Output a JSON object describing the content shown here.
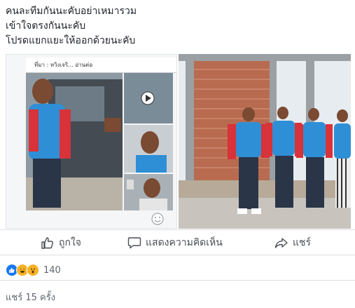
{
  "post": {
    "lines": [
      "คนละทีมกันนะคับอย่าเหมารวม",
      "เข้าใจตรงกันนะคับ",
      "โปรดแยกแยะให้ออกด้วยนะคับ"
    ]
  },
  "media": {
    "left_image": {
      "source_strip_text": "ที่มา : หวิงเจริ... อ่านต่อ"
    }
  },
  "actions": {
    "like_label": "ถูกใจ",
    "comment_label": "แสดงความคิดเห็น",
    "share_label": "แชร์"
  },
  "stats": {
    "reaction_count": "140",
    "share_text": "แชร์ 15 ครั้ง"
  },
  "colors": {
    "like_blue": "#1877f2",
    "haha_yellow": "#f7b125",
    "text_dark": "#1d2129",
    "text_muted": "#616770"
  }
}
